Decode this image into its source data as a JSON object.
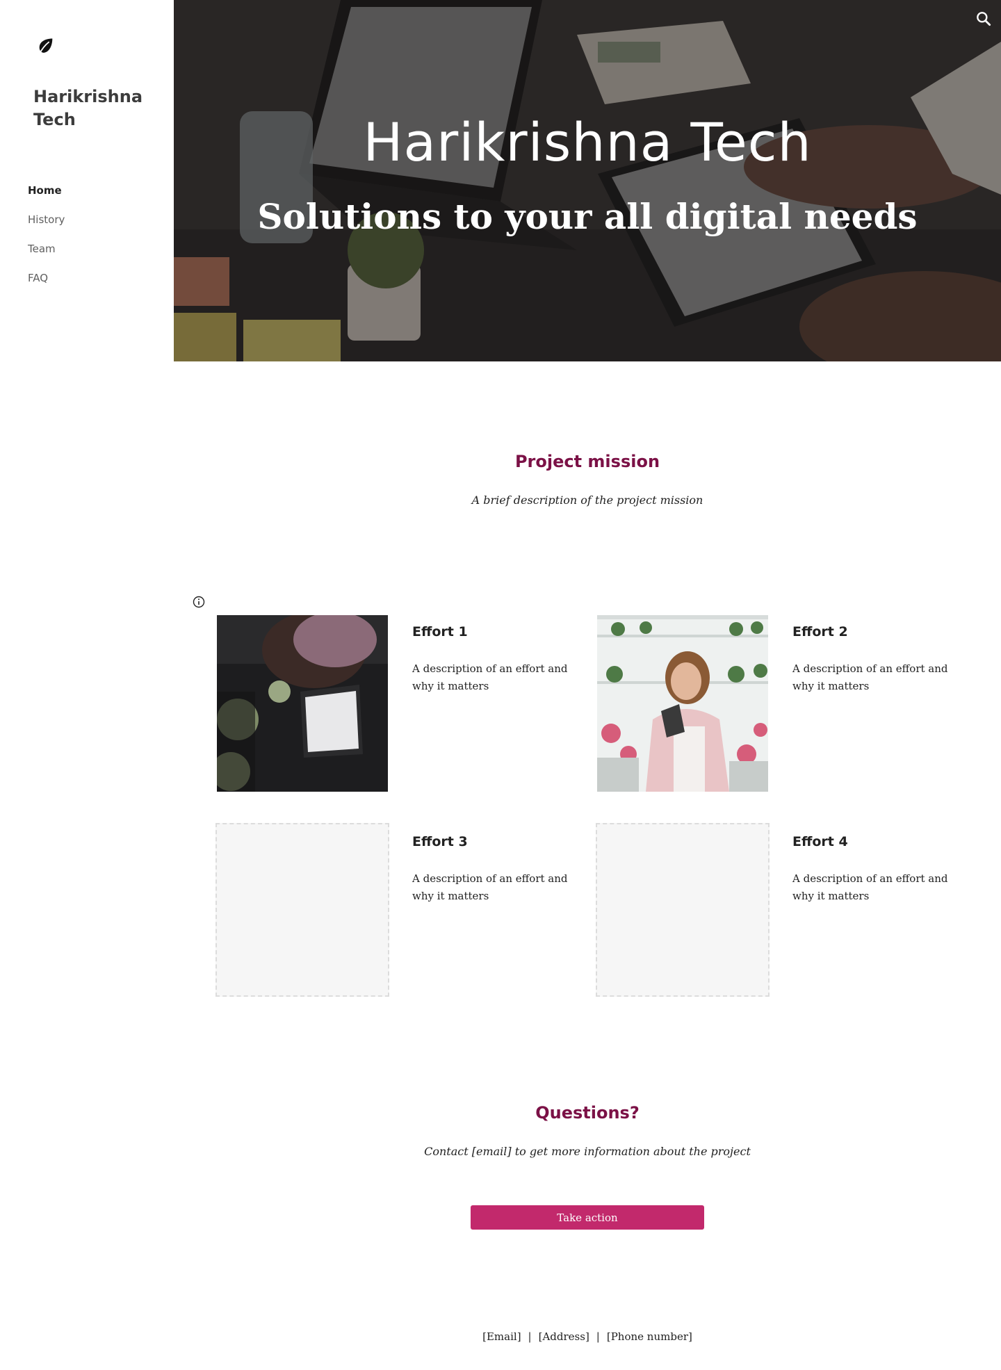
{
  "sidebar": {
    "logo_icon": "leaf-icon",
    "title": "Harikrishna Tech",
    "nav": [
      {
        "label": "Home",
        "active": true
      },
      {
        "label": "History"
      },
      {
        "label": "Team"
      },
      {
        "label": "FAQ"
      }
    ]
  },
  "header": {
    "search_icon": "search-icon",
    "title": "Harikrishna Tech",
    "subtitle": "Solutions to your all digital needs"
  },
  "mission": {
    "heading": "Project mission",
    "text": "A brief description of the project mission"
  },
  "efforts": [
    {
      "title": "Effort 1",
      "description": "A description of an effort and why it matters"
    },
    {
      "title": "Effort 2",
      "description": "A description of an effort and why it matters"
    },
    {
      "title": "Effort 3",
      "description": "A description of an effort and why it matters"
    },
    {
      "title": "Effort 4",
      "description": "A description of an effort and why it matters"
    }
  ],
  "questions": {
    "heading": "Questions?",
    "text": "Contact [email] to get more information about the project",
    "button_label": "Take action"
  },
  "footer": {
    "email": "[Email]",
    "address": "[Address]",
    "phone": "[Phone number]",
    "separator": "|"
  },
  "colors": {
    "accent_heading": "#7b1146",
    "button": "#c2296c"
  }
}
